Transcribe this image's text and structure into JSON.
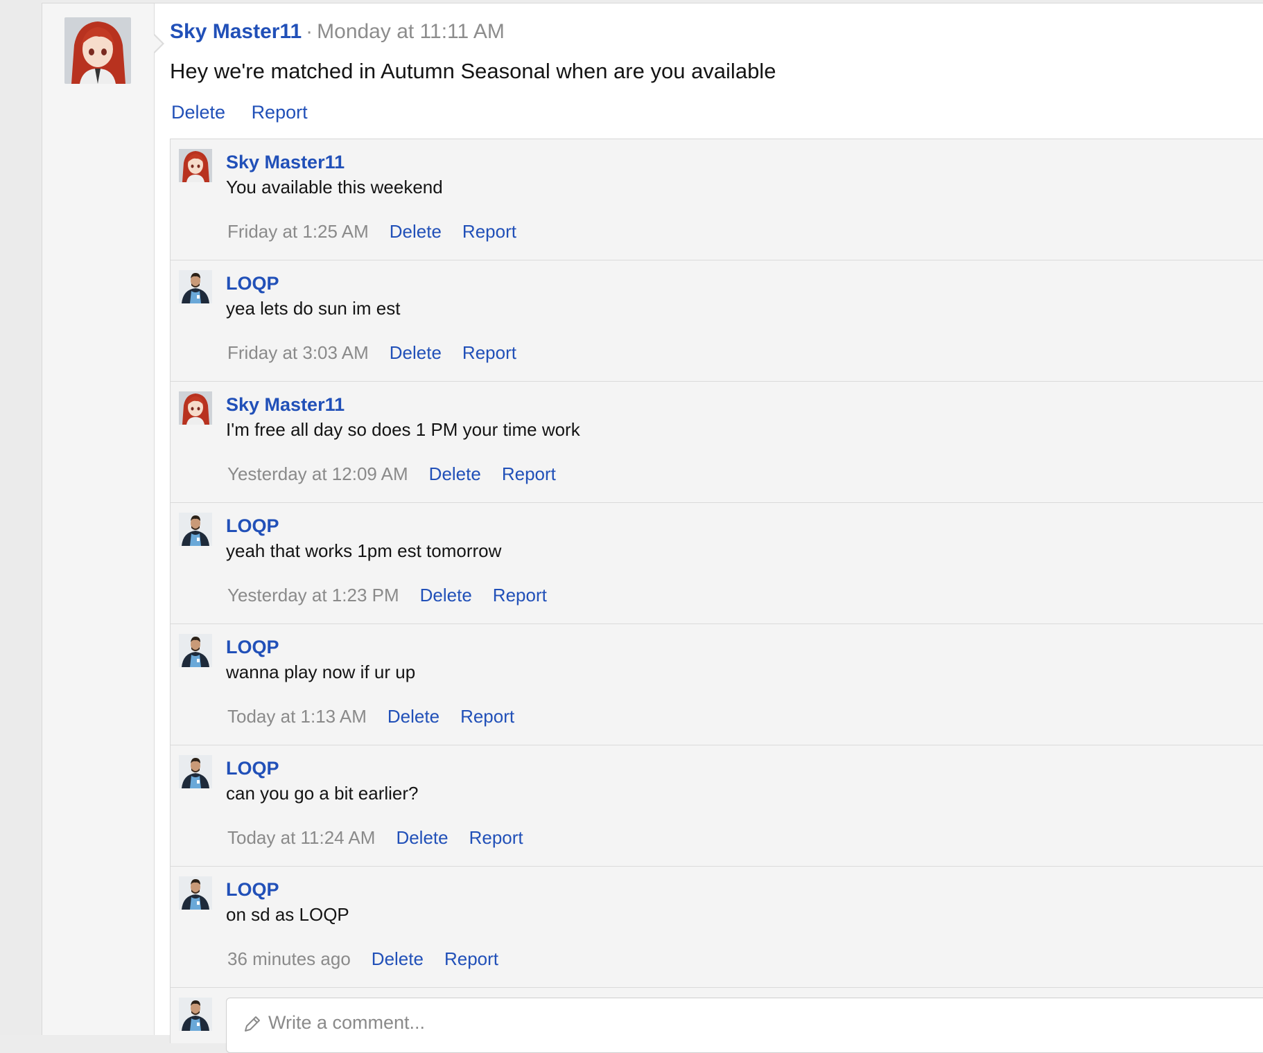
{
  "post": {
    "author": "Sky Master11",
    "separator": "·",
    "date": "Monday at 11:11 AM",
    "body": "Hey we're matched in Autumn Seasonal when are you available",
    "delete_label": "Delete",
    "report_label": "Report"
  },
  "comments": [
    {
      "author": "Sky Master11",
      "avatar": "anime-girl-avatar",
      "text": "You available this weekend",
      "time": "Friday at 1:25 AM",
      "delete": "Delete",
      "report": "Report"
    },
    {
      "author": "LOQP",
      "avatar": "man-hoodie-avatar",
      "text": "yea lets do sun im est",
      "time": "Friday at 3:03 AM",
      "delete": "Delete",
      "report": "Report"
    },
    {
      "author": "Sky Master11",
      "avatar": "anime-girl-avatar",
      "text": "I'm free all day so does 1 PM your time work",
      "time": "Yesterday at 12:09 AM",
      "delete": "Delete",
      "report": "Report"
    },
    {
      "author": "LOQP",
      "avatar": "man-hoodie-avatar",
      "text": "yeah that works 1pm est tomorrow",
      "time": "Yesterday at 1:23 PM",
      "delete": "Delete",
      "report": "Report"
    },
    {
      "author": "LOQP",
      "avatar": "man-hoodie-avatar",
      "text": "wanna play now if ur up",
      "time": "Today at 1:13 AM",
      "delete": "Delete",
      "report": "Report"
    },
    {
      "author": "LOQP",
      "avatar": "man-hoodie-avatar",
      "text": "can you go a bit earlier?",
      "time": "Today at 11:24 AM",
      "delete": "Delete",
      "report": "Report"
    },
    {
      "author": "LOQP",
      "avatar": "man-hoodie-avatar",
      "text": "on sd as LOQP",
      "time": "36 minutes ago",
      "delete": "Delete",
      "report": "Report"
    }
  ],
  "comment_form": {
    "placeholder": "Write a comment...",
    "icon": "pencil-icon"
  },
  "colors": {
    "link": "#2150b8",
    "muted": "#8a8a8a",
    "comment_bg": "#f4f4f4"
  }
}
